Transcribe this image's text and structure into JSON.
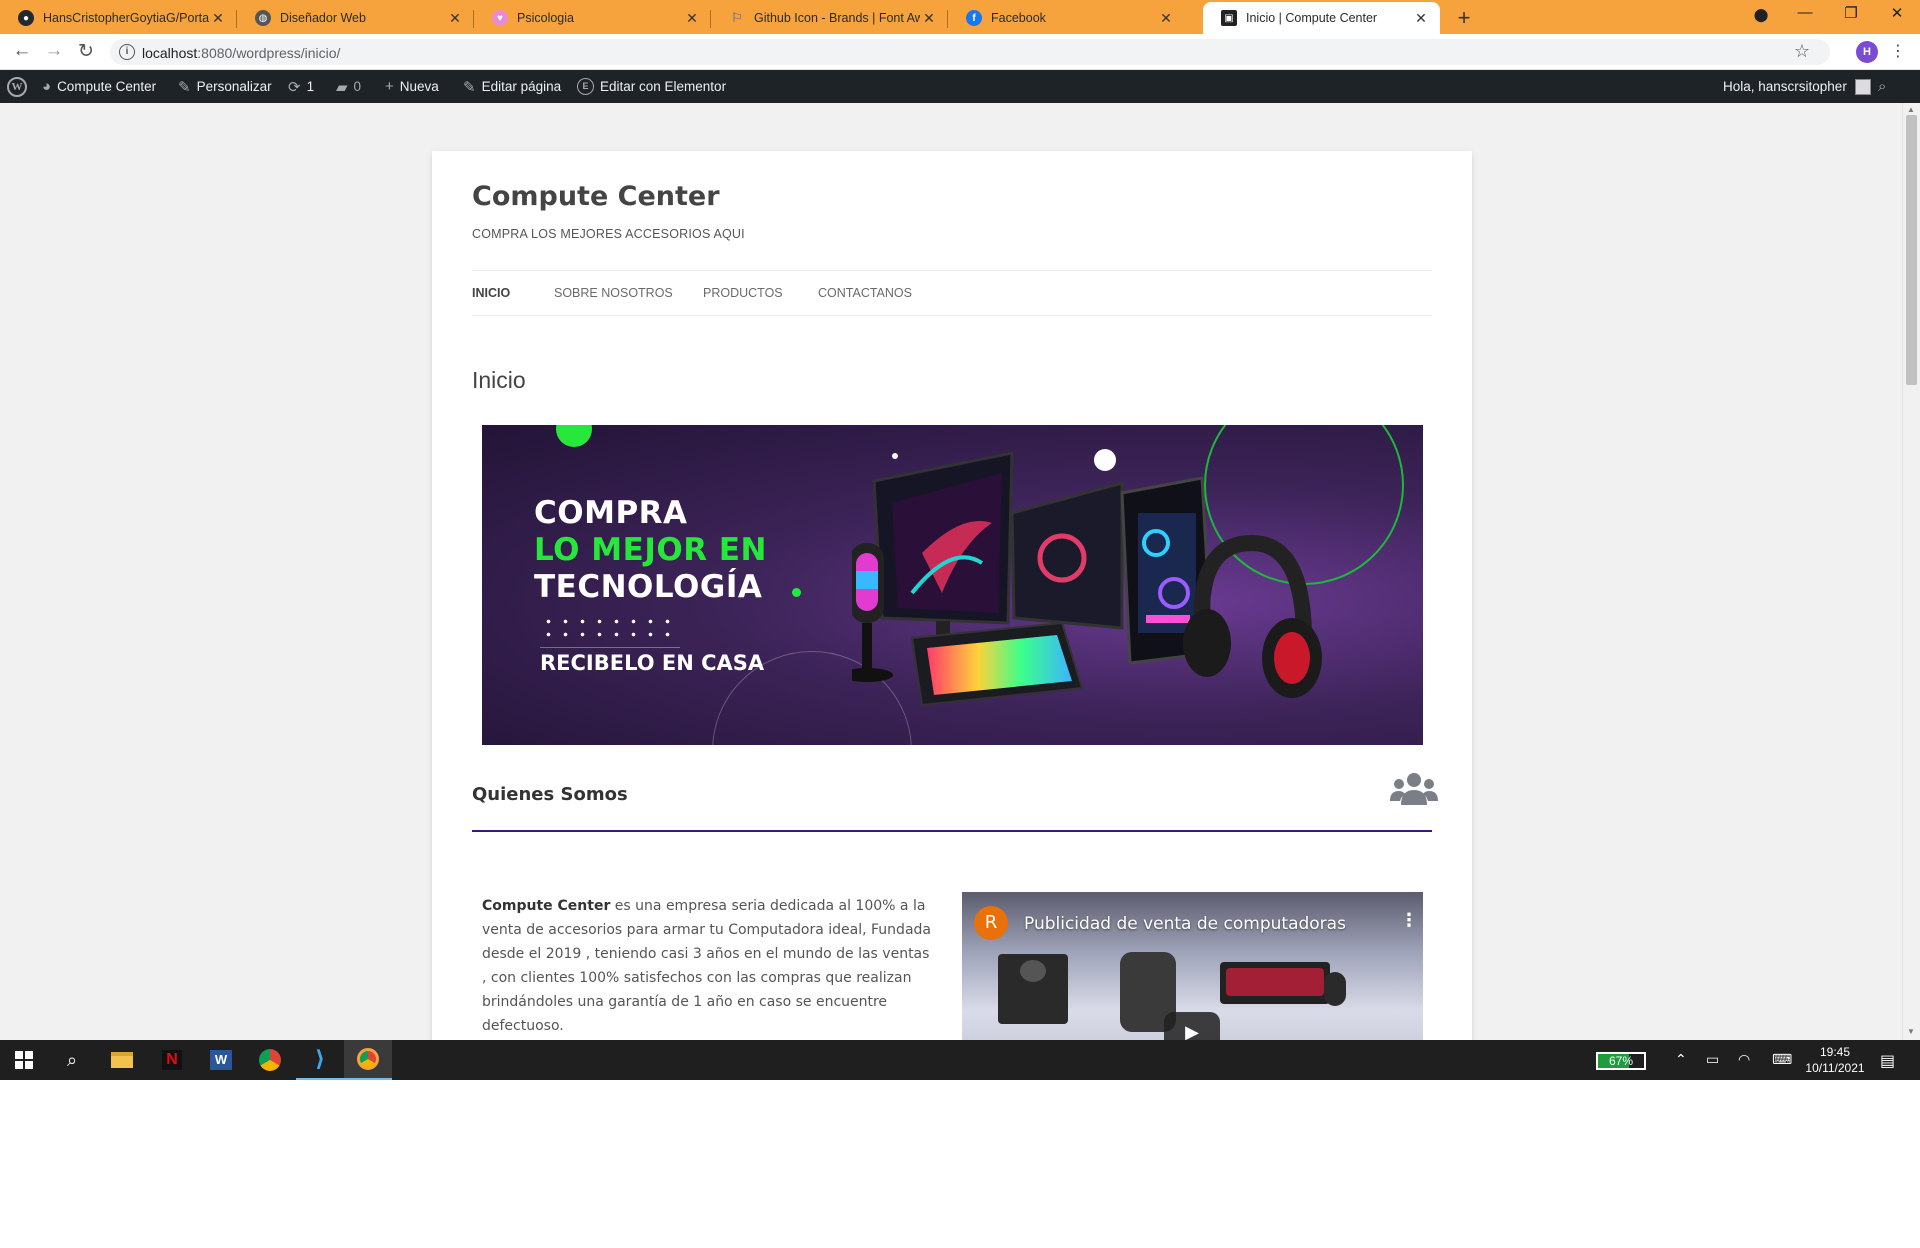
{
  "browser": {
    "tabs": [
      {
        "label": "HansCristopherGoytiaG/Portafoli",
        "favicon": "github-icon",
        "active": false
      },
      {
        "label": "Diseñador Web",
        "favicon": "globe-icon",
        "active": false
      },
      {
        "label": "Psicologia",
        "favicon": "heart-icon",
        "active": false
      },
      {
        "label": "Github Icon - Brands | Font Awe",
        "favicon": "flag-icon",
        "active": false
      },
      {
        "label": "Facebook",
        "favicon": "facebook-icon",
        "active": false
      },
      {
        "label": "Inicio | Compute Center",
        "favicon": "site-icon",
        "active": true
      }
    ],
    "url_host": "localhost",
    "url_rest": ":8080/wordpress/inicio/",
    "profile_initial": "H",
    "accent_color": "#f6a33e"
  },
  "adminbar": {
    "site_name": "Compute Center",
    "customize": "Personalizar",
    "updates_count": "1",
    "comments_count": "0",
    "new_label": "Nueva",
    "edit_page": "Editar página",
    "edit_elementor": "Editar con Elementor",
    "howdy": "Hola, hanscrsitopher"
  },
  "site": {
    "title": "Compute Center",
    "description": "COMPRA LOS MEJORES ACCESORIOS AQUI",
    "nav": [
      "INICIO",
      "SOBRE NOSOTROS",
      "PRODUCTOS",
      "CONTACTANOS"
    ],
    "page_heading": "Inicio"
  },
  "banner": {
    "line1": "COMPRA",
    "line2": "LO MEJOR EN",
    "line3": "TECNOLOGÍA",
    "line4": "RECIBELO EN CASA",
    "highlight_color": "#26e83a"
  },
  "about": {
    "title": "Quienes Somos",
    "icon": "users-icon",
    "text_bold": "Compute Center",
    "text_rest": " es una empresa seria dedicada al 100% a la venta de accesorios para armar tu Computadora ideal, Fundada desde el 2019 , teniendo casi 3 años en el mundo de las ventas , con clientes 100% satisfechos con las compras que realizan brindándoles una garantía de 1 año en caso se encuentre defectuoso."
  },
  "video": {
    "channel_initial": "R",
    "title": "Publicidad de venta de computadoras"
  },
  "taskbar": {
    "battery": "67%",
    "battery_level": 0.67,
    "time": "19:45",
    "date": "10/11/2021"
  }
}
